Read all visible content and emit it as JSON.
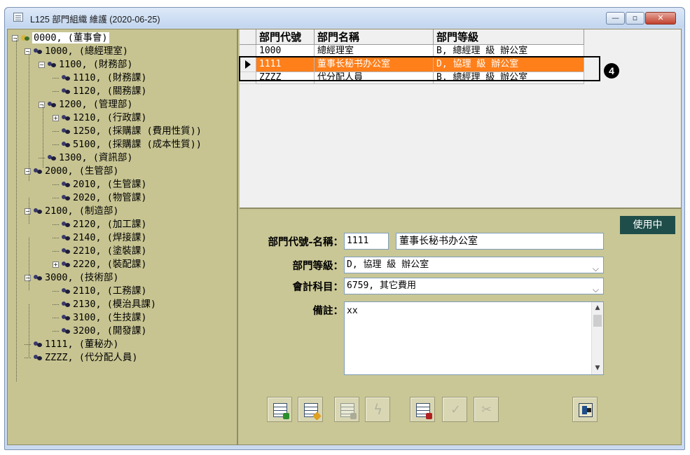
{
  "window": {
    "title": "L125 部門組織 維護 (2020-06-25)"
  },
  "tree": {
    "nodes": [
      {
        "id": "0000",
        "label": "0000, (董事會)"
      },
      {
        "id": "1000",
        "label": "1000, (總經理室)"
      },
      {
        "id": "1100",
        "label": "1100, (財務部)"
      },
      {
        "id": "1110",
        "label": "1110, (財務課)"
      },
      {
        "id": "1120",
        "label": "1120, (關務課)"
      },
      {
        "id": "1200",
        "label": "1200, (管理部)"
      },
      {
        "id": "1210",
        "label": "1210, (行政課)"
      },
      {
        "id": "1250",
        "label": "1250, (採購課 (費用性質))"
      },
      {
        "id": "5100",
        "label": "5100, (採購課 (成本性質))"
      },
      {
        "id": "1300",
        "label": "1300, (資訊部)"
      },
      {
        "id": "2000",
        "label": "2000, (生管部)"
      },
      {
        "id": "2010",
        "label": "2010, (生管課)"
      },
      {
        "id": "2020",
        "label": "2020, (物管課)"
      },
      {
        "id": "2100",
        "label": "2100, (制造部)"
      },
      {
        "id": "2120",
        "label": "2120, (加工課)"
      },
      {
        "id": "2140",
        "label": "2140, (焊接課)"
      },
      {
        "id": "2210",
        "label": "2210, (塗裝課)"
      },
      {
        "id": "2220",
        "label": "2220, (裝配課)"
      },
      {
        "id": "3000",
        "label": "3000, (技術部)"
      },
      {
        "id": "2110",
        "label": "2110, (工務課)"
      },
      {
        "id": "2130",
        "label": "2130, (模治具課)"
      },
      {
        "id": "3100",
        "label": "3100, (生技課)"
      },
      {
        "id": "3200",
        "label": "3200, (開發課)"
      },
      {
        "id": "1111",
        "label": "1111, (董秘办)"
      },
      {
        "id": "ZZZZ",
        "label": "ZZZZ, (代分配人員)"
      }
    ]
  },
  "grid": {
    "headers": [
      "部門代號",
      "部門名稱",
      "部門等級"
    ],
    "rows": [
      [
        "1000",
        "總經理室",
        "B, 總經理 級 辦公室"
      ],
      [
        "1111",
        "董事长秘书办公室",
        "D, 協理 級 辦公室"
      ],
      [
        "ZZZZ",
        "代分配人員",
        "B, 總經理 級 辦公室"
      ]
    ],
    "selected_row": 1
  },
  "callout": {
    "number": "4"
  },
  "form": {
    "status": "使用中",
    "code_name_label": "部門代號-名稱：",
    "code_value": "1111",
    "name_value": "董事长秘书办公室",
    "level_label": "部門等級：",
    "level_value": "D, 協理 級 辦公室",
    "account_label": "會計科目：",
    "account_value": "6759, 其它費用",
    "remark_label": "備註：",
    "remark_value": "xx"
  },
  "toolbar": {
    "buttons": [
      {
        "name": "add-record-button",
        "icon": "table-add-icon",
        "enabled": true
      },
      {
        "name": "edit-record-button",
        "icon": "table-edit-icon",
        "enabled": true
      },
      {
        "name": "delete-record-button",
        "icon": "table-delete-icon",
        "enabled": false
      },
      {
        "name": "lightning-button",
        "icon": "lightning-icon",
        "enabled": false
      },
      {
        "name": "view-record-button",
        "icon": "table-view-icon",
        "enabled": true
      },
      {
        "name": "confirm-button",
        "icon": "check-icon",
        "enabled": false
      },
      {
        "name": "cancel-button",
        "icon": "scissors-icon",
        "enabled": false
      },
      {
        "name": "exit-button",
        "icon": "exit-door-icon",
        "enabled": true
      }
    ]
  }
}
